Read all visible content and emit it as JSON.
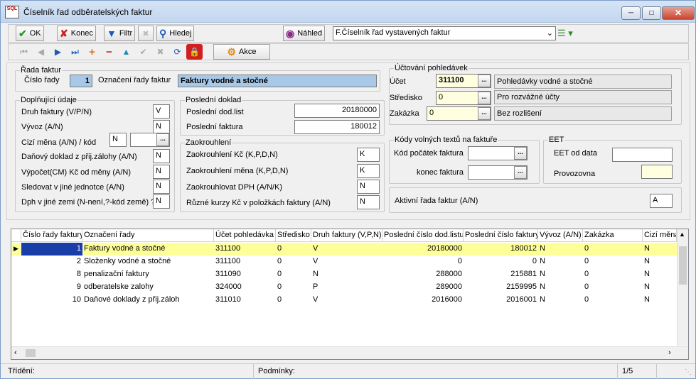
{
  "window": {
    "title": "Číselník řad odběratelských faktur",
    "logo_text": "SQL"
  },
  "toolbar": {
    "ok": "OK",
    "konec": "Konec",
    "filtr": "Filtr",
    "hledej": "Hledej",
    "nahled": "Náhled",
    "report_select": "F.Číselník řad vystavených faktur",
    "akce": "Akce"
  },
  "rada": {
    "legend": "Řada faktur",
    "cislo_label": "Číslo řady",
    "cislo_value": "1",
    "oznaceni_label": "Označení řady faktur",
    "oznaceni_value": "Faktury vodné a stočné"
  },
  "doplnujici": {
    "legend": "Doplňující údaje",
    "druh_label": "Druh faktury (V/P/N)",
    "druh_value": "V",
    "vyvoz_label": "Vývoz (A/N)",
    "vyvoz_value": "N",
    "cizi_label": "Cizí měna (A/N) / kód",
    "cizi_value": "N",
    "cizi_kod": "",
    "danovy_label": "Daňový doklad z přij.zálohy (A/N)",
    "danovy_value": "N",
    "vypocet_label": "Výpočet(CM) Kč od měny (A/N)",
    "vypocet_value": "N",
    "sledovat_label": "Sledovat v jiné jednotce (A/N)",
    "sledovat_value": "N",
    "dph_label": "Dph v jiné zemi (N-není,?-kód země) ?",
    "dph_value": "N"
  },
  "posledni": {
    "legend": "Poslední doklad",
    "dodlist_label": "Poslední dod.list",
    "dodlist_value": "20180000",
    "faktura_label": "Poslední faktura",
    "faktura_value": "180012"
  },
  "zaokrouhleni": {
    "legend": "Zaokrouhlení",
    "kc_label": "Zaokrouhlení Kč (K,P,D,N)",
    "kc_value": "K",
    "mena_label": "Zaokrouhlení měna (K,P,D,N)",
    "mena_value": "K",
    "dph_label": "Zaokrouhlovat DPH (A/N/K)",
    "dph_value": "N",
    "kurzy_label": "Různé kurzy Kč v položkách faktury (A/N)",
    "kurzy_value": "N"
  },
  "uctovani": {
    "legend": "Účtování pohledávek",
    "ucet_label": "Účet",
    "ucet_value": "311100",
    "ucet_desc": "Pohledávky vodné a stočné",
    "stredisko_label": "Středisko",
    "stredisko_value": "0",
    "stredisko_desc": "Pro rozvážné účty",
    "zakazka_label": "Zakázka",
    "zakazka_value": "0",
    "zakazka_desc": "Bez rozlišení"
  },
  "kody": {
    "legend": "Kódy volných textů na faktuře",
    "pocatek_label": "Kód počátek faktura",
    "pocatek_value": "",
    "konec_label": "konec faktura",
    "konec_value": ""
  },
  "eet": {
    "legend": "EET",
    "od_label": "EET od data",
    "od_value": "",
    "provozovna_label": "Provozovna",
    "provozovna_value": ""
  },
  "aktivni": {
    "label": "Aktivní řada faktur (A/N)",
    "value": "A"
  },
  "grid": {
    "columns": [
      "Číslo řady faktury",
      "Označení řady",
      "Účet pohledávka",
      "Středisko",
      "Druh faktury (V,P,N)",
      "Poslední číslo dod.listu",
      "Poslední číslo faktury",
      "Vývoz (A/N)",
      "Zakázka",
      "Cizí měna"
    ],
    "rows": [
      [
        "1",
        "Faktury vodné a stočné",
        "311100",
        "0",
        "V",
        "20180000",
        "180012",
        "N",
        "0",
        "N"
      ],
      [
        "2",
        "Složenky vodné a stočné",
        "311100",
        "0",
        "V",
        "0",
        "0",
        "N",
        "0",
        "N"
      ],
      [
        "8",
        "penalizační faktury",
        "311090",
        "0",
        "N",
        "288000",
        "215881",
        "N",
        "0",
        "N"
      ],
      [
        "9",
        "odberatelske zalohy",
        "324000",
        "0",
        "P",
        "289000",
        "2159995",
        "N",
        "0",
        "N"
      ],
      [
        "10",
        "Daňové doklady z přij.záloh",
        "311010",
        "0",
        "V",
        "2016000",
        "2016001",
        "N",
        "0",
        "N"
      ]
    ]
  },
  "status": {
    "trideni": "Třídění:",
    "podminky": "Podmínky:",
    "pozice": "1/5"
  },
  "colors": {
    "selected_row": "#ffff99",
    "title_bg": "#c3d6ef",
    "ok_green": "#2a9a2a",
    "konec_red": "#cc2222"
  }
}
